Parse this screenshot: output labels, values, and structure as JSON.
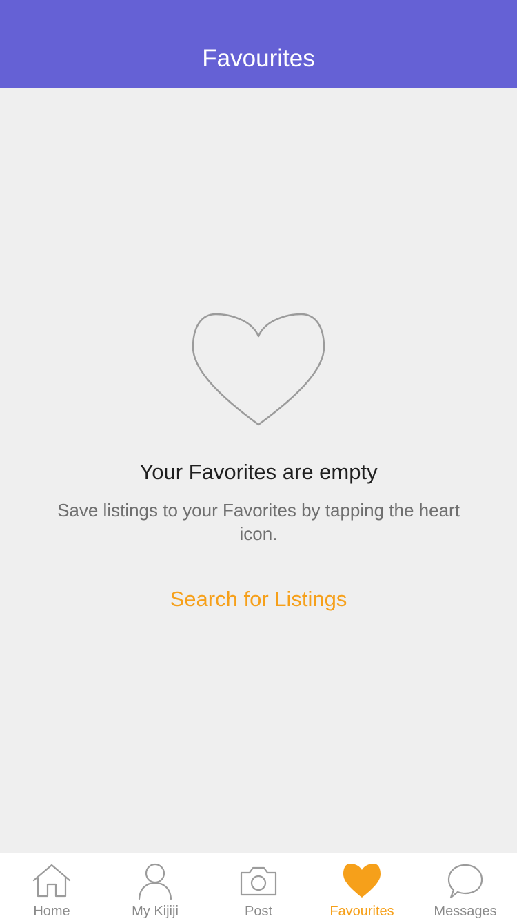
{
  "header": {
    "title": "Favourites"
  },
  "empty_state": {
    "icon": "heart-outline-icon",
    "title": "Your Favorites are empty",
    "description": "Save listings to your Favorites by tapping the heart icon.",
    "action_label": "Search for Listings"
  },
  "tabbar": {
    "items": [
      {
        "label": "Home",
        "icon": "home-icon",
        "active": false
      },
      {
        "label": "My Kijiji",
        "icon": "user-icon",
        "active": false
      },
      {
        "label": "Post",
        "icon": "camera-icon",
        "active": false
      },
      {
        "label": "Favourites",
        "icon": "heart-icon",
        "active": true
      },
      {
        "label": "Messages",
        "icon": "chat-bubble-icon",
        "active": false
      }
    ]
  },
  "colors": {
    "header_background": "#6561d5",
    "page_background": "#efefef",
    "accent": "#f6a01a",
    "inactive_tab": "#8a8a8a",
    "heading_text": "#1f1f1f",
    "body_text": "#6f6f6f"
  }
}
